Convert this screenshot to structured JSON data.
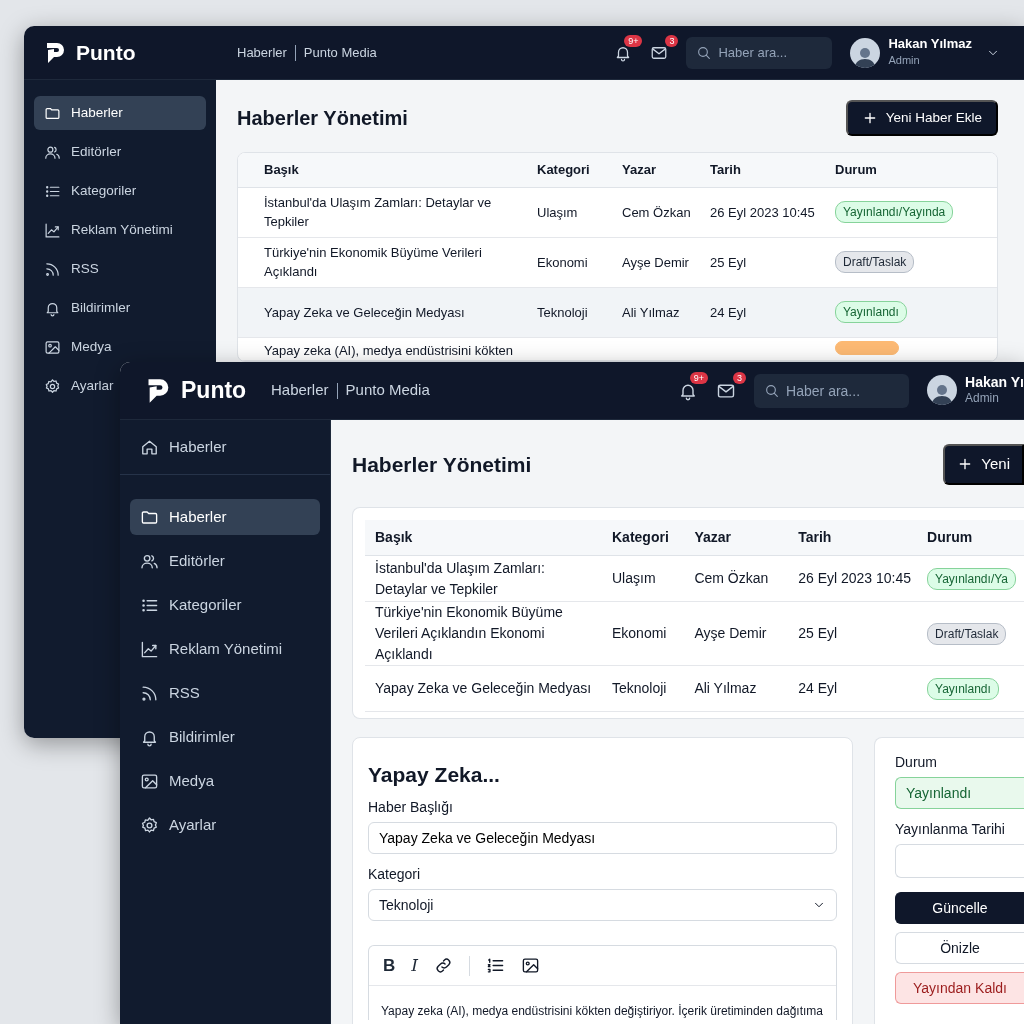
{
  "back_window": {
    "header": {
      "brand": "Punto",
      "breadcrumb": [
        "Haberler",
        "Punto Media"
      ],
      "notification_count": "9+",
      "message_count": "3",
      "search": {
        "placeholder": "Haber ara..."
      },
      "user": {
        "name": "Hakan Yılmaz",
        "role": "Admin"
      }
    },
    "sidebar": {
      "items": [
        {
          "label": "Haberler",
          "selected": true
        },
        {
          "label": "Editörler",
          "selected": false
        },
        {
          "label": "Kategoriler",
          "selected": false
        },
        {
          "label": "Reklam Yönetimi",
          "selected": false
        },
        {
          "label": "RSS",
          "selected": false
        },
        {
          "label": "Bildirimler",
          "selected": false
        },
        {
          "label": "Medya",
          "selected": false
        },
        {
          "label": "Ayarlar",
          "selected": false
        }
      ]
    },
    "page_title": "Haberler Yönetimi",
    "add_button": "Yeni Haber Ekle",
    "table": {
      "columns": [
        "Başık",
        "Kategori",
        "Yazar",
        "Tarih",
        "Durum"
      ],
      "rows": [
        {
          "title": "İstanbul'da Ulaşım Zamları: Detaylar ve Tepkiler",
          "category": "Ulaşım",
          "author": "Cem Özkan",
          "date": "26 Eyl 2023 10:45",
          "status": {
            "label": "Yayınlandı/Yayında",
            "kind": "published"
          },
          "selected": false
        },
        {
          "title": "Türkiye'nin Ekonomik Büyüme Verileri Açıklandı",
          "category": "Ekonomi",
          "author": "Ayşe Demir",
          "date": "25 Eyl",
          "status": {
            "label": "Draft/Taslak",
            "kind": "draft"
          },
          "selected": false
        },
        {
          "title": "Yapay Zeka ve Geleceğin Medyası",
          "category": "Teknoloji",
          "author": "Ali Yılmaz",
          "date": "24 Eyl",
          "status": {
            "label": "Yayınlandı",
            "kind": "published"
          },
          "selected": true
        }
      ],
      "partial_row": {
        "title": "Yapay zeka (AI), medya endüstrisini kökten",
        "status": {
          "color": "#fdba74"
        }
      }
    }
  },
  "front_window": {
    "header": {
      "brand": "Punto",
      "breadcrumb": [
        "Haberler",
        "Punto Media"
      ],
      "notification_count": "9+",
      "message_count": "3",
      "search": {
        "placeholder": "Haber ara..."
      },
      "user": {
        "name": "Hakan Yı",
        "role": "Admin"
      }
    },
    "sidebar": {
      "home_item": {
        "label": "Haberler"
      },
      "items": [
        {
          "label": "Haberler",
          "selected": true
        },
        {
          "label": "Editörler",
          "selected": false
        },
        {
          "label": "Kategoriler",
          "selected": false
        },
        {
          "label": "Reklam Yönetimi",
          "selected": false
        },
        {
          "label": "RSS",
          "selected": false
        },
        {
          "label": "Bildirimler",
          "selected": false
        },
        {
          "label": "Medya",
          "selected": false
        },
        {
          "label": "Ayarlar",
          "selected": false
        }
      ]
    },
    "page_title": "Haberler Yönetimi",
    "add_button": "Yeni",
    "table": {
      "columns": [
        "Başık",
        "Kategori",
        "Yazar",
        "Tarih",
        "Durum"
      ],
      "rows": [
        {
          "title": "İstanbul'da Ulaşım Zamları: Detaylar ve Tepkiler",
          "category": "Ulaşım",
          "author": "Cem Özkan",
          "date": "26 Eyl 2023 10:45",
          "status": {
            "label": "Yayınlandı/Ya",
            "kind": "published"
          },
          "selected": false
        },
        {
          "title": "Türkiye'nin Ekonomik Büyüme Verileri Açıklandın Ekonomi Açıklandı",
          "category": "Ekonomi",
          "author": "Ayşe Demir",
          "date": "25 Eyl",
          "status": {
            "label": "Draft/Taslak",
            "kind": "draft"
          },
          "selected": false
        },
        {
          "title": "Yapay Zeka ve Geleceğin Medyası",
          "category": "Teknoloji",
          "author": "Ali Yılmaz",
          "date": "24 Eyl",
          "status": {
            "label": "Yayınlandı",
            "kind": "published"
          },
          "selected": false
        }
      ]
    },
    "editor": {
      "title": "Yapay Zeka...",
      "fields": [
        {
          "label": "Haber Başlığı",
          "kind": "text",
          "value": "Yapay Zeka ve Geleceğin Medyası"
        },
        {
          "label": "Kategori",
          "kind": "select",
          "value": "Teknoloji"
        }
      ],
      "toolbar": [
        {
          "kind": "bold",
          "label": "B"
        },
        {
          "kind": "italic",
          "label": "I"
        },
        {
          "kind": "link"
        },
        {
          "kind": "list"
        },
        {
          "kind": "image"
        }
      ],
      "body": "Yapay zeka (AI), medya endüstrisini kökten değiştiriyor. İçerik üretiminden dağıtıma"
    },
    "publish_panel": {
      "status": {
        "label": "Durum",
        "value": "Yayınlandı",
        "kind": "published"
      },
      "publish_date": {
        "label": "Yayınlanma Tarihi"
      },
      "buttons": [
        {
          "label": "Güncelle",
          "kind": "primary"
        },
        {
          "label": "Önizle",
          "kind": "secondary"
        },
        {
          "label": "Yayından Kaldı",
          "kind": "danger"
        }
      ]
    }
  }
}
